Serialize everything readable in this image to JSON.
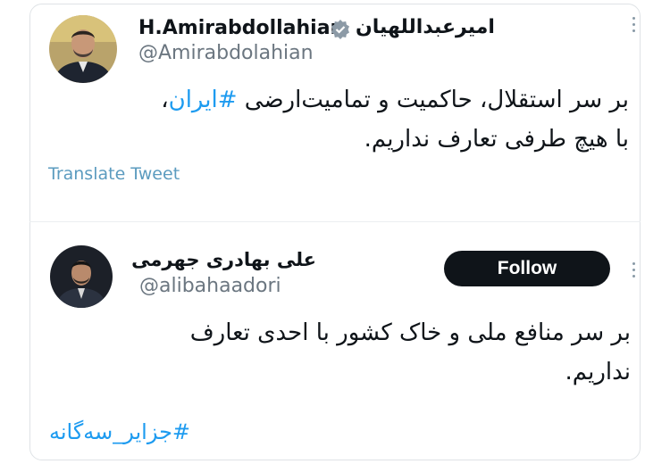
{
  "tweet1": {
    "name_latin": "H.Amirabdollahian",
    "name_persian": "امیرعبداللهیان",
    "handle": "@Amirabdolahian",
    "text_line1_start": "بر سر استقلال، حاکمیت و تمامیت‌ارضی ",
    "text_hashtag": "#ایران",
    "text_line1_end": "،",
    "text_line2": "با هیچ طرفی تعارف نداریم.",
    "translate_label": "Translate Tweet"
  },
  "tweet2": {
    "name": "علی بهادری جهرمی",
    "handle": "@alibahaadori",
    "follow_label": "Follow",
    "text_line1": "بر سر منافع ملی و خاک کشور با احدی تعارف",
    "text_line2": "نداریم.",
    "hashtag": "#جزایر_سه‌گانه"
  },
  "colors": {
    "accent": "#1d9bf0",
    "verified": "#8c9aa6",
    "button_bg": "#0f1419",
    "translate": "#5b9bbf"
  }
}
